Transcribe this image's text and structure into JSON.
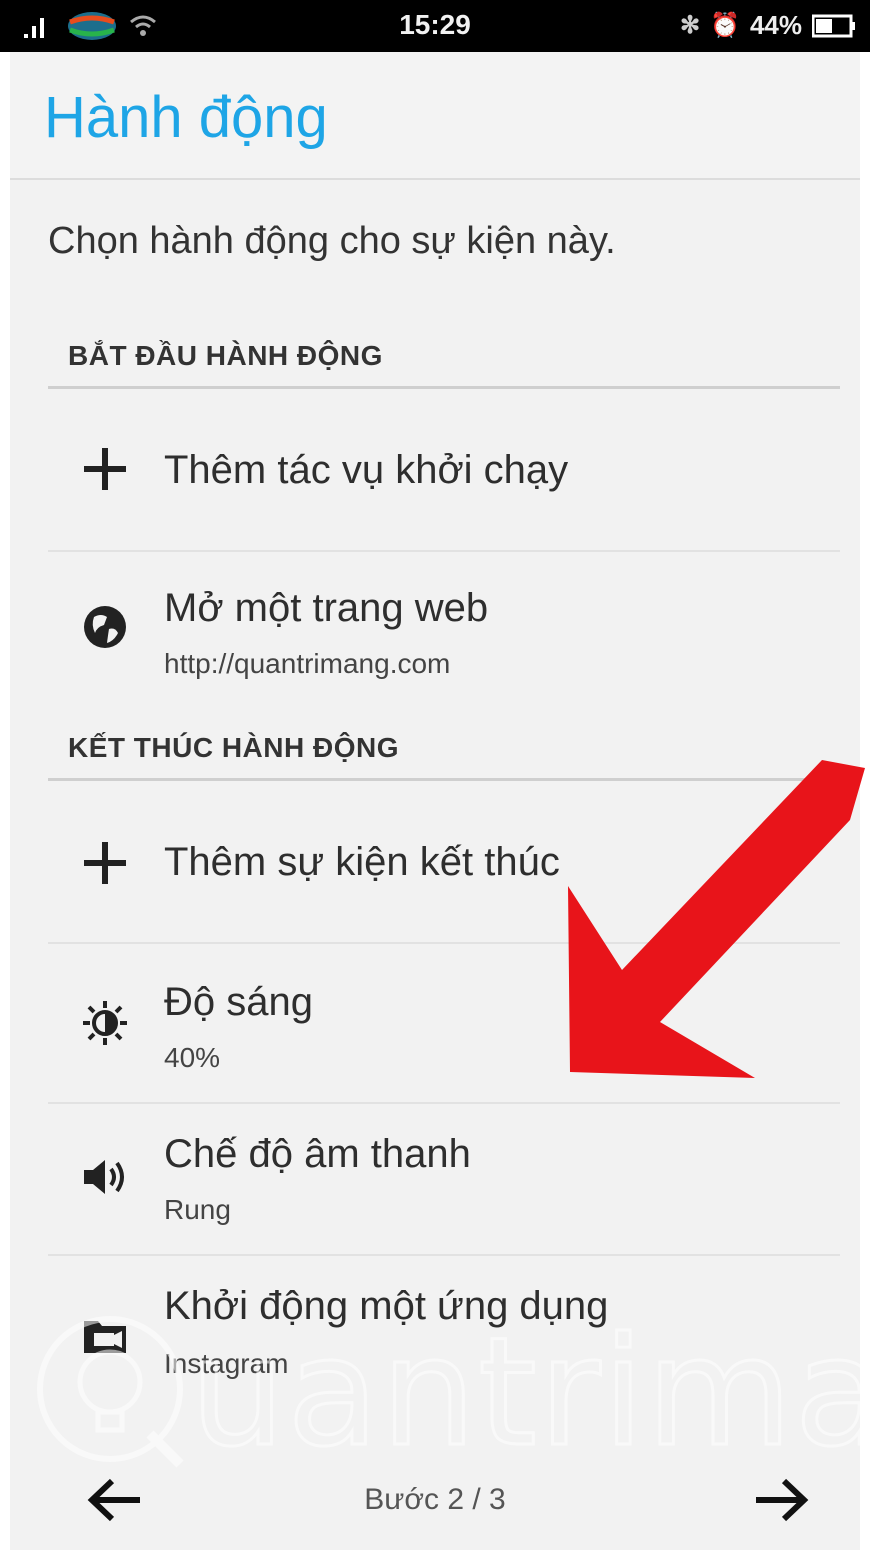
{
  "status_bar": {
    "time": "15:29",
    "battery_percent": "44%",
    "icons": [
      "signal-icon",
      "carrier-logo-icon",
      "wifi-icon",
      "bluetooth-icon",
      "alarm-icon",
      "battery-icon"
    ]
  },
  "header": {
    "title": "Hành động"
  },
  "description": "Chọn hành động cho sự kiện này.",
  "start_section": {
    "heading": "BẮT ĐẦU HÀNH ĐỘNG",
    "items": [
      {
        "icon": "plus-icon",
        "label": "Thêm tác vụ khởi chạy",
        "sub": ""
      },
      {
        "icon": "globe-icon",
        "label": "Mở một trang web",
        "sub": "http://quantrimang.com"
      }
    ]
  },
  "end_section": {
    "heading": "KẾT THÚC HÀNH ĐỘNG",
    "items": [
      {
        "icon": "plus-icon",
        "label": "Thêm sự kiện kết thúc",
        "sub": ""
      },
      {
        "icon": "brightness-icon",
        "label": "Độ sáng",
        "sub": "40%"
      },
      {
        "icon": "volume-icon",
        "label": "Chế độ âm thanh",
        "sub": "Rung"
      },
      {
        "icon": "app-launch-icon",
        "label": "Khởi động một ứng dụng",
        "sub": "Instagram"
      }
    ]
  },
  "watermark": {
    "text": "uantrimang"
  },
  "footer": {
    "step_label": "Bước 2 / 3"
  },
  "colors": {
    "title": "#1ea5e6",
    "arrow": "#e8141a",
    "background": "#f2f2f2"
  }
}
